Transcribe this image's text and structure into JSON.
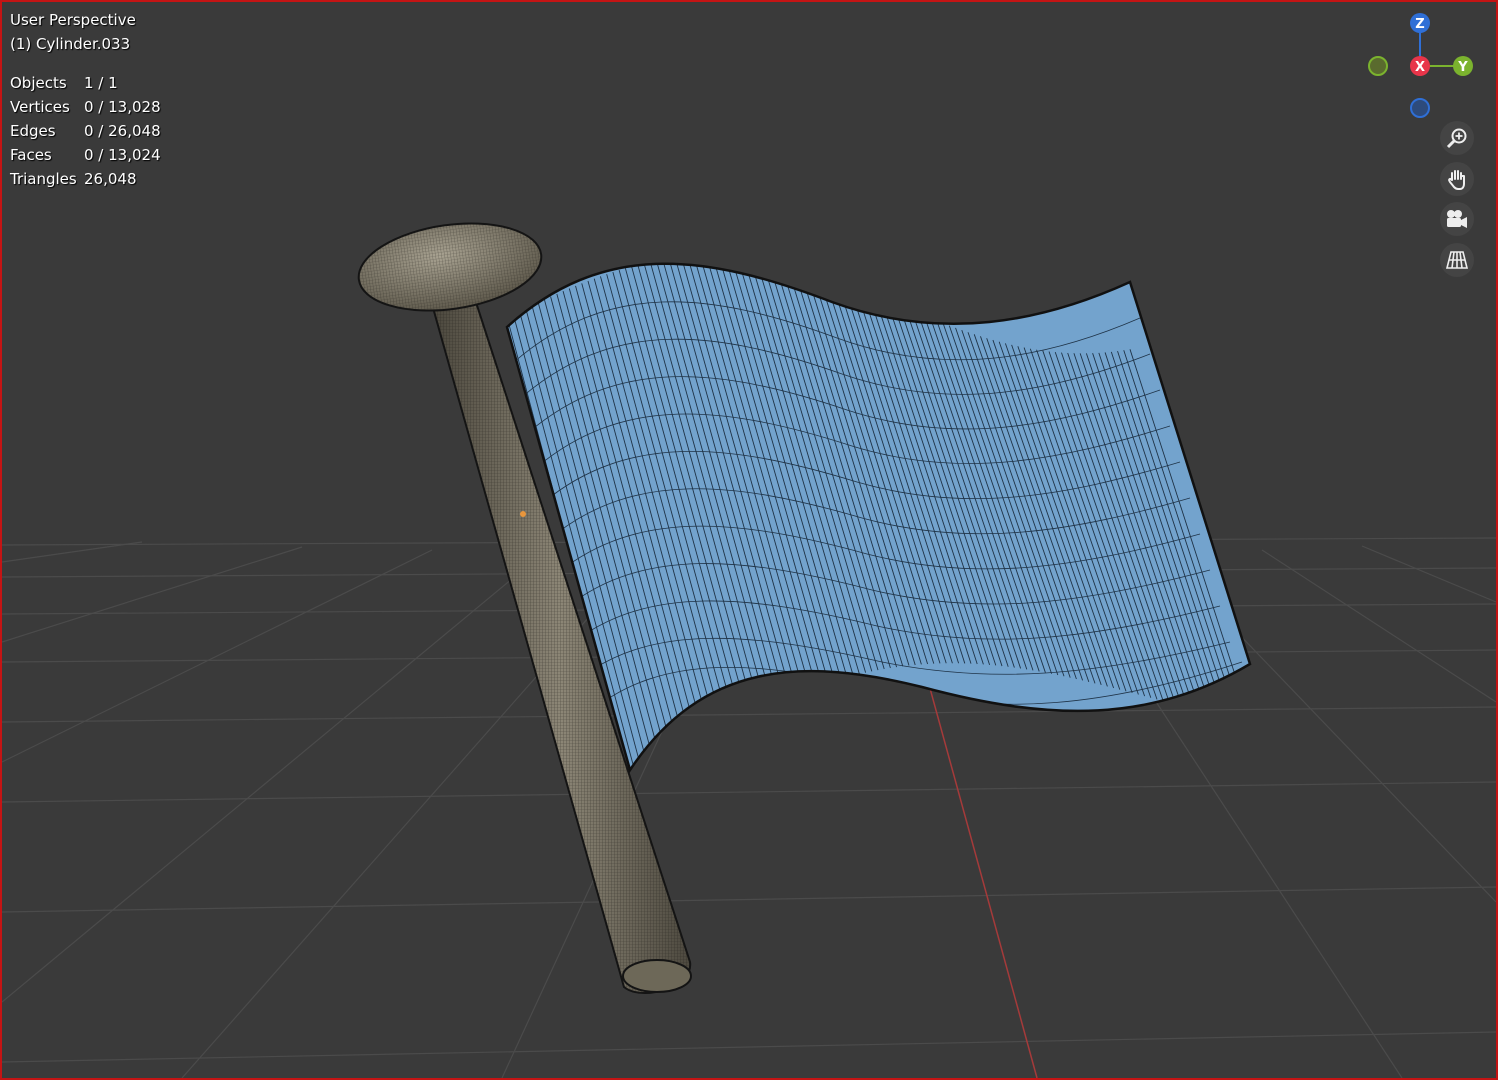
{
  "viewport": {
    "title": "User Perspective",
    "object_name": "(1) Cylinder.033"
  },
  "stats": [
    {
      "label": "Objects",
      "value": "1 / 1"
    },
    {
      "label": "Vertices",
      "value": "0 / 13,028"
    },
    {
      "label": "Edges",
      "value": "0 / 26,048"
    },
    {
      "label": "Faces",
      "value": "0 / 13,024"
    },
    {
      "label": "Triangles",
      "value": "26,048"
    }
  ],
  "gizmo": {
    "z_label": "Z",
    "x_label": "X",
    "y_label": "Y",
    "z_color": "#2f6fd6",
    "x_color": "#e8354a",
    "y_color": "#7bb32e"
  },
  "nav_icons": [
    "zoom-icon",
    "hand-pan-icon",
    "camera-icon",
    "grid-perspective-icon"
  ],
  "colors": {
    "background": "#3a3a3a",
    "grid_line": "#4a4a4a",
    "x_axis_line": "#a53a3a",
    "flag_cloth": "#6f9fc9",
    "pole": "#7d7868",
    "selection_border": "#c41414"
  }
}
